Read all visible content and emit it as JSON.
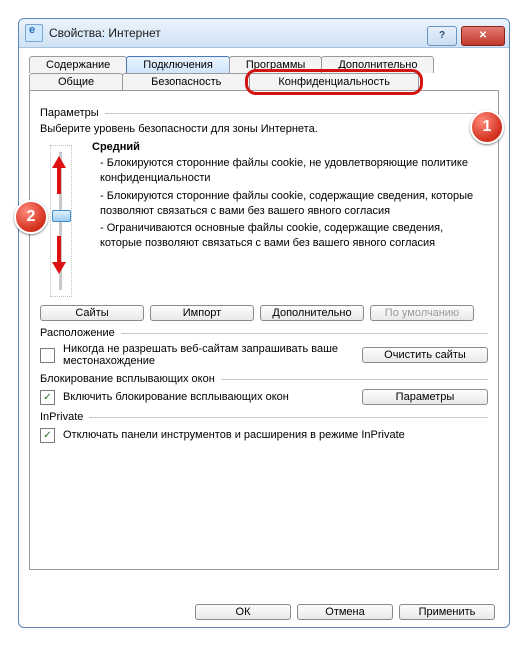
{
  "window": {
    "title": "Свойства: Интернет"
  },
  "tabs": {
    "row1": [
      {
        "label": "Содержание"
      },
      {
        "label": "Подключения",
        "selected": true
      },
      {
        "label": "Программы"
      },
      {
        "label": "Дополнительно"
      }
    ],
    "row2": [
      {
        "label": "Общие"
      },
      {
        "label": "Безопасность"
      },
      {
        "label": "Конфиденциальность",
        "highlight": true
      }
    ]
  },
  "groups": {
    "params": "Параметры",
    "location": "Расположение",
    "popup": "Блокирование всплывающих окон",
    "inprivate": "InPrivate"
  },
  "privacy": {
    "zone_desc": "Выберите уровень безопасности для зоны Интернета.",
    "level": "Средний",
    "bullets": [
      "- Блокируются сторонние файлы cookie, не удовлетворяющие политике конфиденциальности",
      "- Блокируются сторонние файлы cookie, содержащие сведения, которые позволяют связаться с вами без вашего явного согласия",
      "- Ограничиваются основные файлы cookie, содержащие сведения, которые позволяют связаться с вами без вашего явного согласия"
    ],
    "buttons": {
      "sites": "Сайты",
      "import": "Импорт",
      "advanced": "Дополнительно",
      "default": "По умолчанию"
    }
  },
  "location": {
    "never_allow": "Никогда не разрешать веб-сайтам запрашивать ваше местонахождение",
    "clear_sites": "Очистить сайты"
  },
  "popup": {
    "enable": "Включить блокирование всплывающих окон",
    "params": "Параметры"
  },
  "inprivate": {
    "disable_toolbars": "Отключать панели инструментов и расширения в режиме InPrivate"
  },
  "bottom": {
    "ok": "ОК",
    "cancel": "Отмена",
    "apply": "Применить"
  },
  "annotations": {
    "badge1": "1",
    "badge2": "2"
  }
}
